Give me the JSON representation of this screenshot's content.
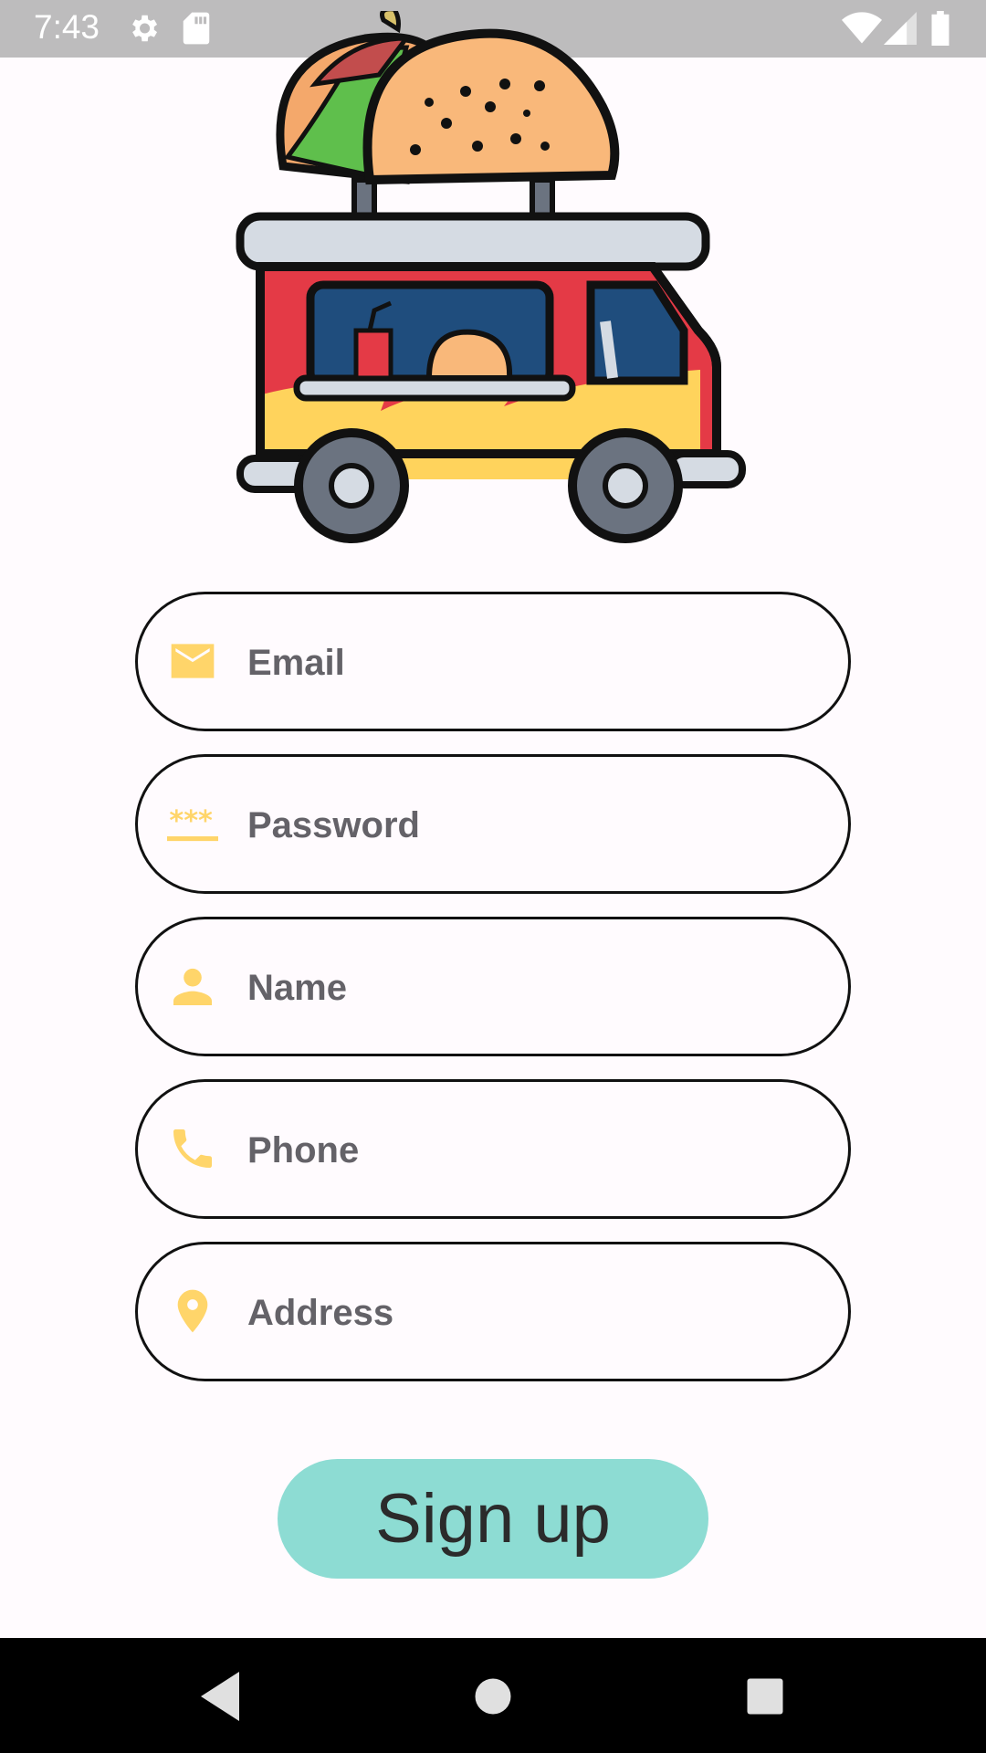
{
  "status_bar": {
    "time": "7:43",
    "icons": [
      "settings-icon",
      "sd-card-icon",
      "wifi-icon",
      "signal-icon",
      "battery-icon"
    ]
  },
  "logo": {
    "description_icon": "taco-food-truck-logo"
  },
  "form": {
    "email": {
      "placeholder": "Email",
      "icon": "mail-icon"
    },
    "password": {
      "placeholder": "Password",
      "icon": "password-icon"
    },
    "name": {
      "placeholder": "Name",
      "icon": "person-icon"
    },
    "phone": {
      "placeholder": "Phone",
      "icon": "phone-icon"
    },
    "address": {
      "placeholder": "Address",
      "icon": "location-pin-icon"
    }
  },
  "signup_button": {
    "label": "Sign up"
  },
  "nav_bar": {
    "buttons": [
      "back-icon",
      "home-icon",
      "recents-icon"
    ]
  },
  "colors": {
    "accent_icon": "#ffd56a",
    "button": "#8ddcd3",
    "status_bar": "#bdbcbd",
    "background": "#fffbfe"
  }
}
